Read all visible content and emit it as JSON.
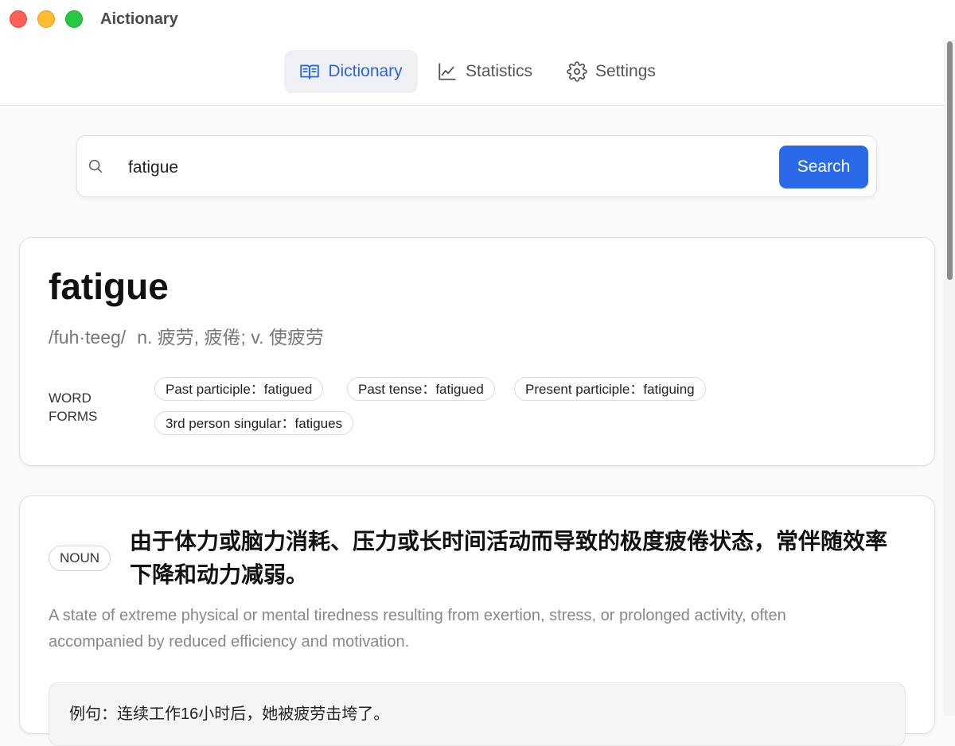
{
  "window": {
    "title": "Aictionary"
  },
  "nav": {
    "tabs": [
      {
        "label": "Dictionary",
        "icon": "book-icon",
        "active": true
      },
      {
        "label": "Statistics",
        "icon": "chart-line-icon",
        "active": false
      },
      {
        "label": "Settings",
        "icon": "gear-icon",
        "active": false
      }
    ]
  },
  "search": {
    "value": "fatigue",
    "placeholder": "",
    "button_label": "Search"
  },
  "entry": {
    "word": "fatigue",
    "phonetic": "/fuh·teeg/",
    "translation": "n. 疲劳, 疲倦; v. 使疲劳",
    "word_forms_label": "WORD FORMS",
    "word_forms": [
      "Past participle：fatigued",
      "Past tense：fatigued",
      "Present participle：fatiguing",
      "3rd person singular：fatigues"
    ]
  },
  "definitions": [
    {
      "pos": "NOUN",
      "zh": "由于体力或脑力消耗、压力或长时间活动而导致的极度疲倦状态，常伴随效率下降和动力减弱。",
      "en": "A state of extreme physical or mental tiredness resulting from exertion, stress, or prolonged activity, often accompanied by reduced efficiency and motivation.",
      "example": "例句：连续工作16小时后，她被疲劳击垮了。"
    }
  ],
  "colors": {
    "accent": "#2a6ae8",
    "active_tab_text": "#2b66de",
    "traffic_red": "#fe5f57",
    "traffic_yellow": "#febc2e",
    "traffic_green": "#28c840"
  }
}
